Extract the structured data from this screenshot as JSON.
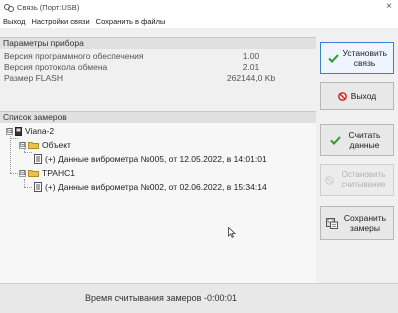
{
  "window": {
    "title": "Связь (Порт:USB)",
    "close_glyph": "×"
  },
  "menu": {
    "items": [
      "Выход",
      "Настройки связи",
      "Сохранить в файлы"
    ]
  },
  "device_params": {
    "header": "Параметры прибора",
    "rows": [
      {
        "label": "Версия программного обеспечения",
        "value": "1.00"
      },
      {
        "label": "Версия протокола обмена",
        "value": "2.01"
      },
      {
        "label": "Размер FLASH",
        "value": "262144,0 Kb"
      }
    ]
  },
  "measurements": {
    "header": "Список замеров",
    "tree": {
      "root": {
        "expander": "⊟",
        "icon": "device-icon",
        "label": "Viana-2"
      },
      "groups": [
        {
          "expander": "⊟",
          "icon": "folder-icon",
          "label": "Объект",
          "items": [
            {
              "icon": "document-icon",
              "label": "(+) Данные виброметра №005, от 12.05.2022, в 14:01:01"
            }
          ]
        },
        {
          "expander": "⊟",
          "icon": "folder-icon",
          "label": "ТРАНС1",
          "items": [
            {
              "icon": "document-icon",
              "label": "(+) Данные виброметра №002, от 02.06.2022, в 15:34:14"
            }
          ]
        }
      ]
    }
  },
  "buttons": {
    "connect": "Установить связь",
    "exit": "Выход",
    "read": "Считать данные",
    "stop": "Остановить считывание",
    "save": "Сохранить замеры"
  },
  "status": {
    "text": "Время считывания замеров -0:00:01"
  },
  "colors": {
    "check_green": "#2e9a2e",
    "exit_red": "#d42020",
    "folder_yellow": "#e8c24a",
    "primary_border": "#3c7fd1"
  }
}
